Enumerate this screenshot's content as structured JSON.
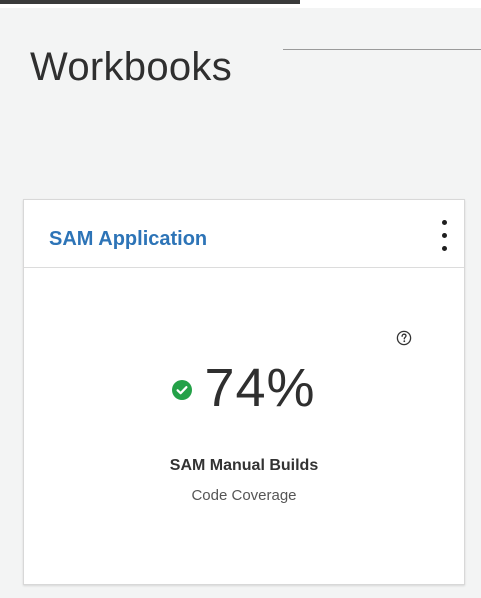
{
  "page": {
    "title": "Workbooks"
  },
  "card": {
    "title": "SAM Application",
    "overflow_menu_icon": "overflow-vertical-icon",
    "help_icon": "help-icon",
    "status_icon": "checkmark-circle-icon",
    "status": "success",
    "metric_value": "74%",
    "metric_fraction": 0.74,
    "metric_name": "SAM Manual Builds",
    "metric_subtitle": "Code Coverage"
  },
  "colors": {
    "background": "#f3f4f4",
    "card_title": "#2d74b7",
    "success": "#24a148",
    "text_primary": "#2f2f2f",
    "text_secondary": "#555555"
  }
}
